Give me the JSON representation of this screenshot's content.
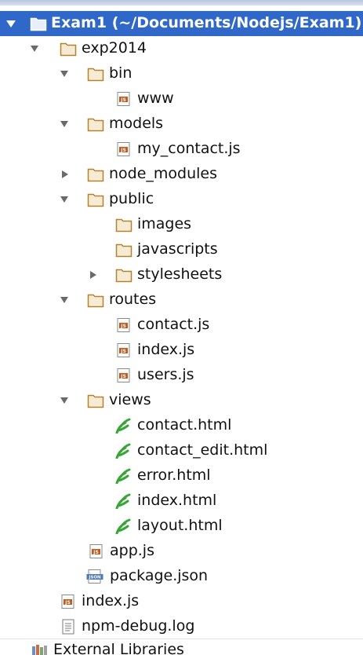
{
  "colors": {
    "selection": "#2f68c9",
    "folder_outline": "#b4812f",
    "folder_fill": "#f7ecd3",
    "js_badge": "#c25a1e",
    "html_leaf": "#3aa33a",
    "json_badge": "#4f79b8"
  },
  "project": {
    "name": "Exam1",
    "path": "(~/Documents/Nodejs/Exam1)"
  },
  "tree": {
    "exp2014": "exp2014",
    "bin": "bin",
    "www": "www",
    "models": "models",
    "my_contact": "my_contact.js",
    "node_modules": "node_modules",
    "public": "public",
    "images": "images",
    "javascripts": "javascripts",
    "stylesheets": "stylesheets",
    "routes": "routes",
    "contact_js": "contact.js",
    "index_js_routes": "index.js",
    "users_js": "users.js",
    "views": "views",
    "contact_html": "contact.html",
    "contact_edit_html": "contact_edit.html",
    "error_html": "error.html",
    "index_html": "index.html",
    "layout_html": "layout.html",
    "app_js": "app.js",
    "package_json": "package.json",
    "index_js_root": "index.js",
    "npm_debug_log": "npm-debug.log",
    "external_libraries": "External Libraries"
  },
  "icons": {
    "badge_js": "JS",
    "badge_json": "JSON"
  }
}
